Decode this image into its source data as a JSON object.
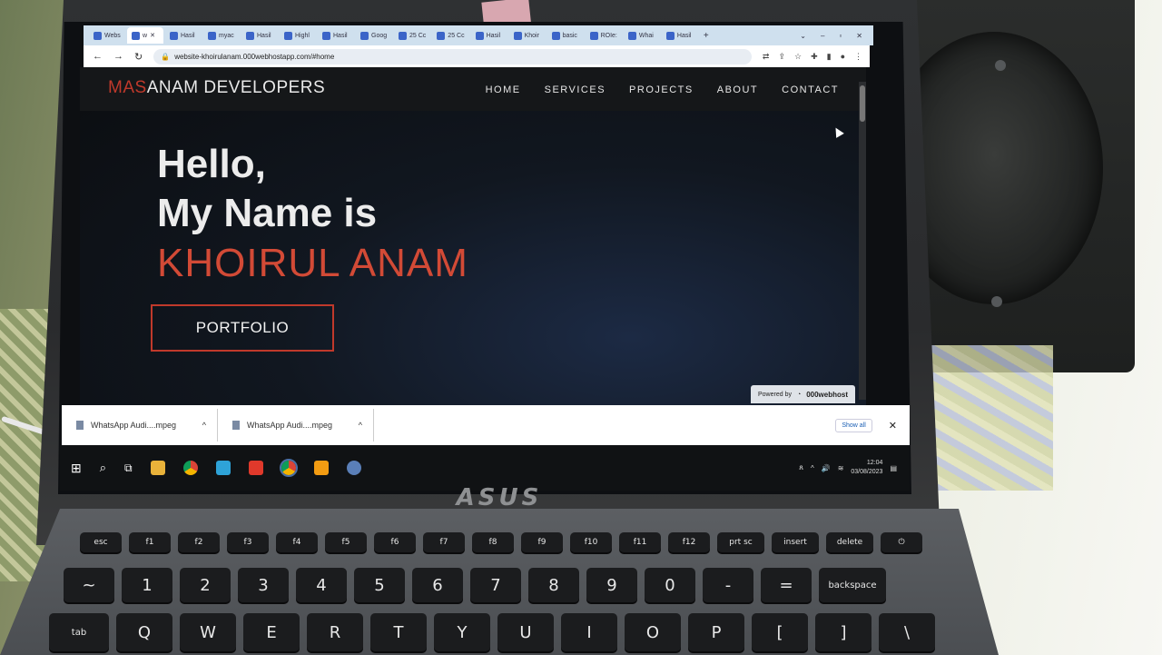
{
  "browser": {
    "tabs": [
      {
        "label": "Webs",
        "active": false
      },
      {
        "label": "w",
        "active": true
      },
      {
        "label": "Hasil",
        "active": false
      },
      {
        "label": "myac",
        "active": false
      },
      {
        "label": "Hasil",
        "active": false
      },
      {
        "label": "Highl",
        "active": false
      },
      {
        "label": "Hasil",
        "active": false
      },
      {
        "label": "Goog",
        "active": false
      },
      {
        "label": "25 Cc",
        "active": false
      },
      {
        "label": "25 Cc",
        "active": false
      },
      {
        "label": "Hasil",
        "active": false
      },
      {
        "label": "Khoir",
        "active": false
      },
      {
        "label": "basic",
        "active": false
      },
      {
        "label": "ROIe:",
        "active": false
      },
      {
        "label": "Whai",
        "active": false
      },
      {
        "label": "Hasil",
        "active": false
      }
    ],
    "new_tab": "+",
    "url": "website-khoirulanam.000webhostapp.com/#home"
  },
  "site": {
    "brand_accent": "MAS",
    "brand_rest": "ANAM DEVELOPERS",
    "menu": [
      "HOME",
      "SERVICES",
      "PROJECTS",
      "ABOUT",
      "CONTACT"
    ],
    "hero": {
      "line1": "Hello,",
      "line2": "My Name is",
      "line3": "KHOIRUL ANAM"
    },
    "cta": "PORTFOLIO",
    "powered_by": "Powered by",
    "host_brand": "000webhost"
  },
  "downloads": {
    "items": [
      "WhatsApp Audi....mpeg",
      "WhatsApp Audi....mpeg"
    ],
    "show_all": "Show all"
  },
  "taskbar": {
    "time": "12:04",
    "date": "03/08/2023"
  },
  "laptop": {
    "logo": "ASUS"
  },
  "keyboard": {
    "row_fn": [
      "esc",
      "f1",
      "f2",
      "f3",
      "f4",
      "f5",
      "f6",
      "f7",
      "f8",
      "f9",
      "f10",
      "f11",
      "f12",
      "prt sc",
      "insert",
      "delete",
      "⏻"
    ],
    "row_num": [
      "~",
      "1",
      "2",
      "3",
      "4",
      "5",
      "6",
      "7",
      "8",
      "9",
      "0",
      "-",
      "=",
      "backspace"
    ],
    "row_q": [
      "tab",
      "Q",
      "W",
      "E",
      "R",
      "T",
      "Y",
      "U",
      "I",
      "O",
      "P",
      "[",
      "]",
      "\\"
    ]
  },
  "colors": {
    "accent_red": "#d24a36",
    "page_bg": "#0b0d10",
    "tab_bar": "#cfe0ee"
  }
}
